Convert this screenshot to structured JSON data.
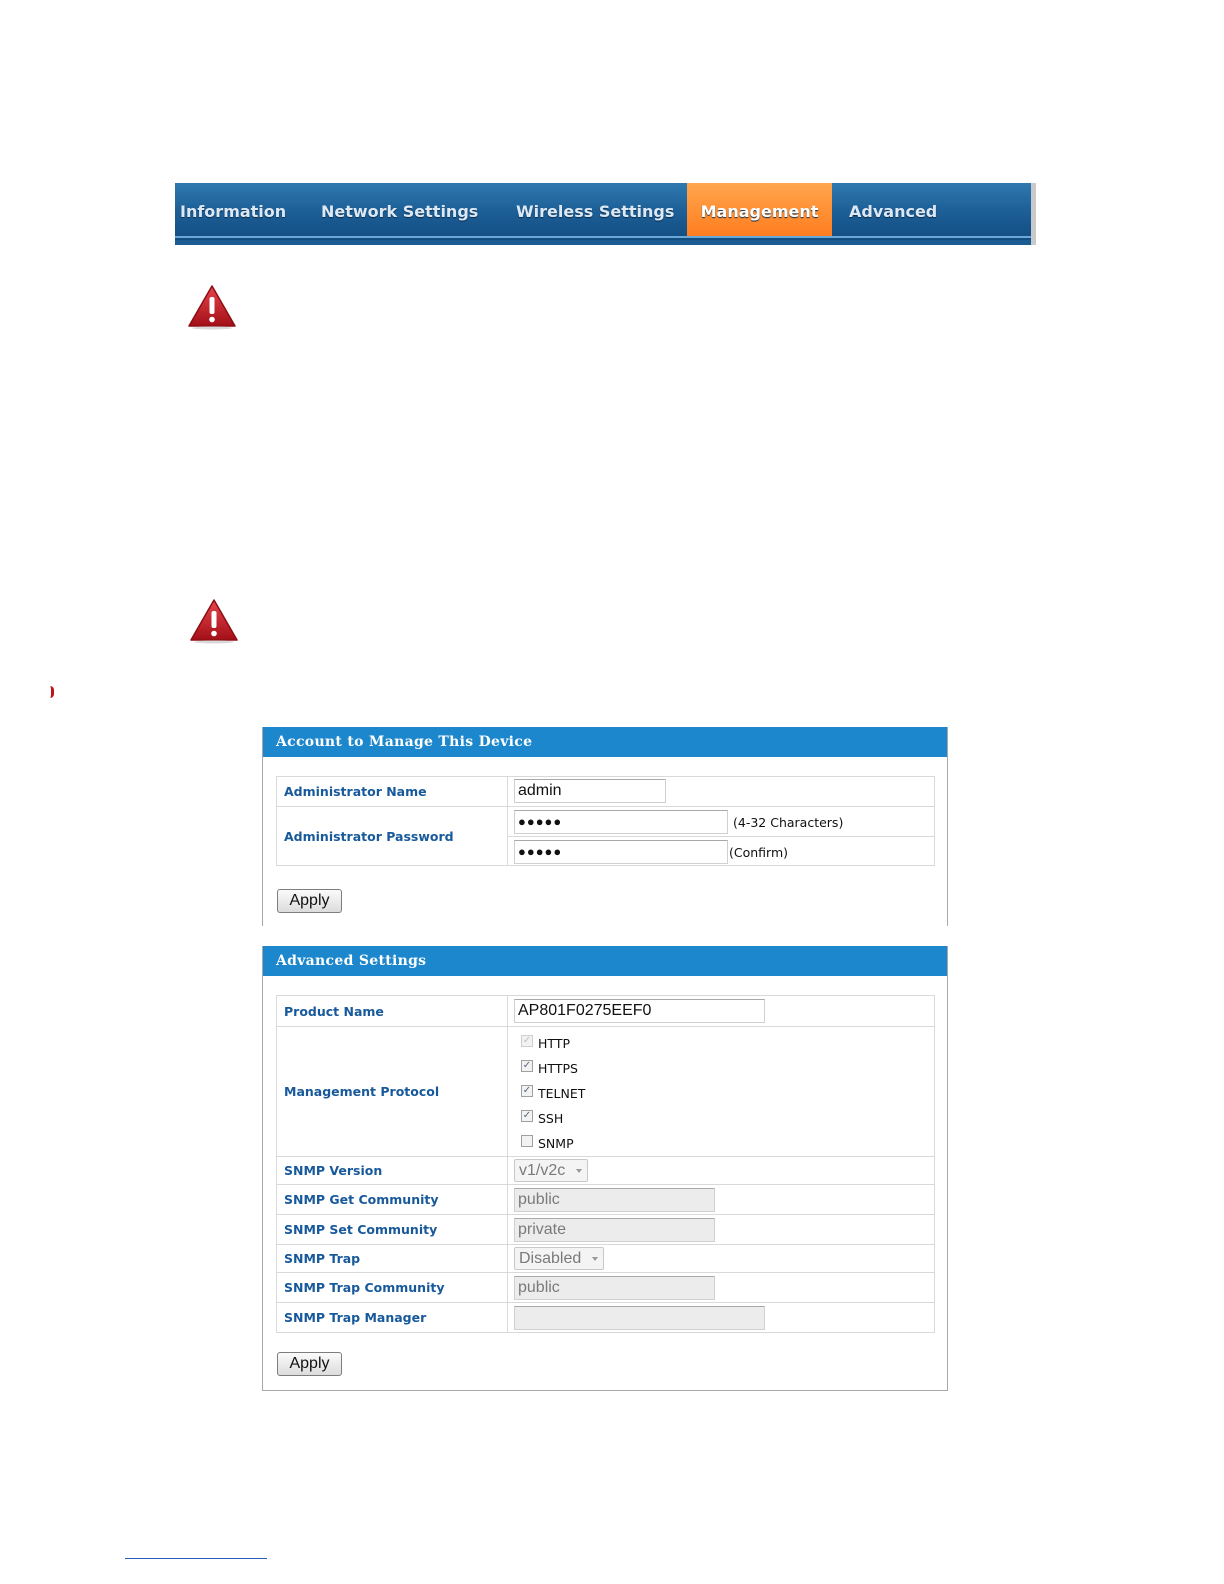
{
  "nav": {
    "tabs": [
      {
        "label": "Information"
      },
      {
        "label": "Network Settings"
      },
      {
        "label": "Wireless Settings"
      },
      {
        "label": "Management",
        "active": true
      },
      {
        "label": "Advanced"
      }
    ]
  },
  "icons": [
    "warning-icon",
    "warning-icon",
    "checkbox-icon",
    "dropdown-arrow-icon"
  ],
  "colors": {
    "nav_blue": "#1d5f97",
    "active_orange": "#ff8c2a",
    "panel_header": "#1c87cc",
    "label_blue": "#17599b",
    "warning_red": "#c8151f"
  },
  "account_panel": {
    "title": "Account to Manage This Device",
    "admin_name_label": "Administrator Name",
    "admin_name_value": "admin",
    "admin_password_label": "Administrator Password",
    "password_value": "●●●●●",
    "confirm_value": "●●●●●",
    "password_hint": "(4-32 Characters)",
    "confirm_hint": "(Confirm)",
    "apply_label": "Apply"
  },
  "advanced_panel": {
    "title": "Advanced Settings",
    "product_name_label": "Product Name",
    "product_name_value": "AP801F0275EEF0",
    "management_protocol_label": "Management Protocol",
    "protocols": [
      {
        "label": "HTTP",
        "checked": true,
        "disabled": true
      },
      {
        "label": "HTTPS",
        "checked": true,
        "disabled": false
      },
      {
        "label": "TELNET",
        "checked": true,
        "disabled": false
      },
      {
        "label": "SSH",
        "checked": true,
        "disabled": false
      },
      {
        "label": "SNMP",
        "checked": false,
        "disabled": false
      }
    ],
    "snmp_version_label": "SNMP Version",
    "snmp_version_value": "v1/v2c",
    "snmp_get_label": "SNMP Get Community",
    "snmp_get_value": "public",
    "snmp_set_label": "SNMP Set Community",
    "snmp_set_value": "private",
    "snmp_trap_label": "SNMP Trap",
    "snmp_trap_value": "Disabled",
    "snmp_trap_community_label": "SNMP Trap Community",
    "snmp_trap_community_value": "public",
    "snmp_trap_manager_label": "SNMP Trap Manager",
    "snmp_trap_manager_value": "",
    "apply_label": "Apply"
  }
}
